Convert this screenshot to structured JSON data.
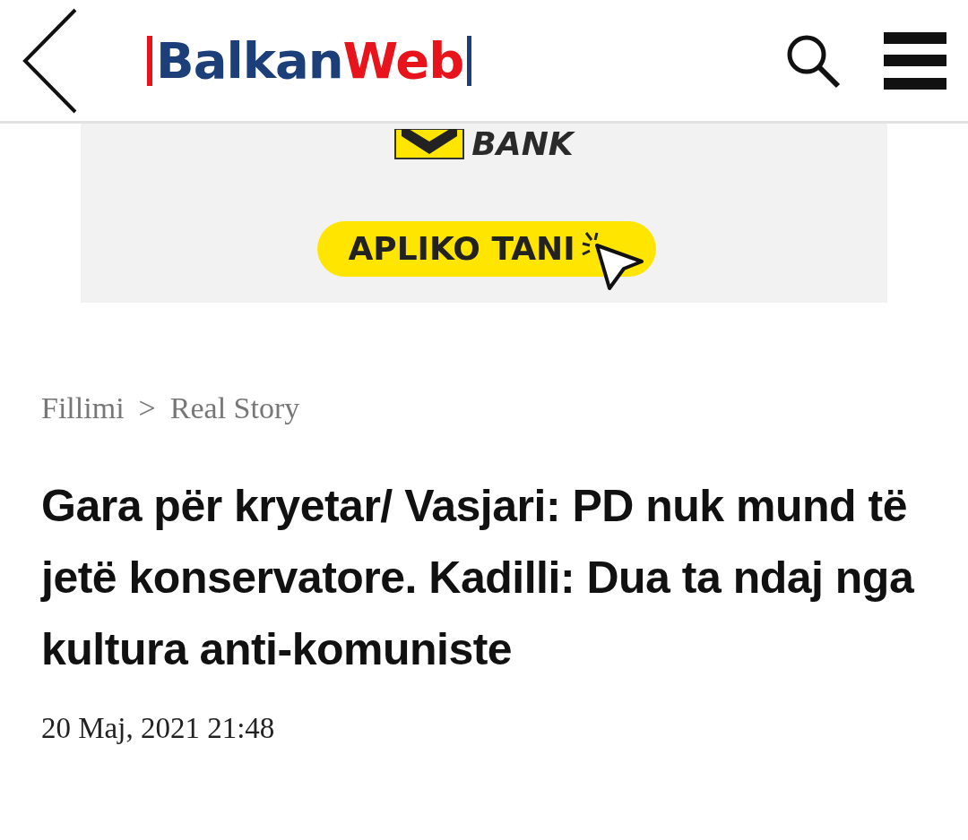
{
  "header": {
    "logo": {
      "part_1": "Balkan",
      "part_2": "Web"
    }
  },
  "ad": {
    "brand": "BANK",
    "button": "APLIKO TANI"
  },
  "breadcrumb": [
    {
      "label": "Fillimi"
    },
    {
      "label": "Real Story"
    }
  ],
  "breadcrumb_separator": ">",
  "article": {
    "title": "Gara për kryetar/ Vasjari: PD nuk mund të jetë konservatore. Kadilli: Dua ta ndaj nga kultura anti-komuniste",
    "date": "20 Maj, 2021 21:48"
  }
}
